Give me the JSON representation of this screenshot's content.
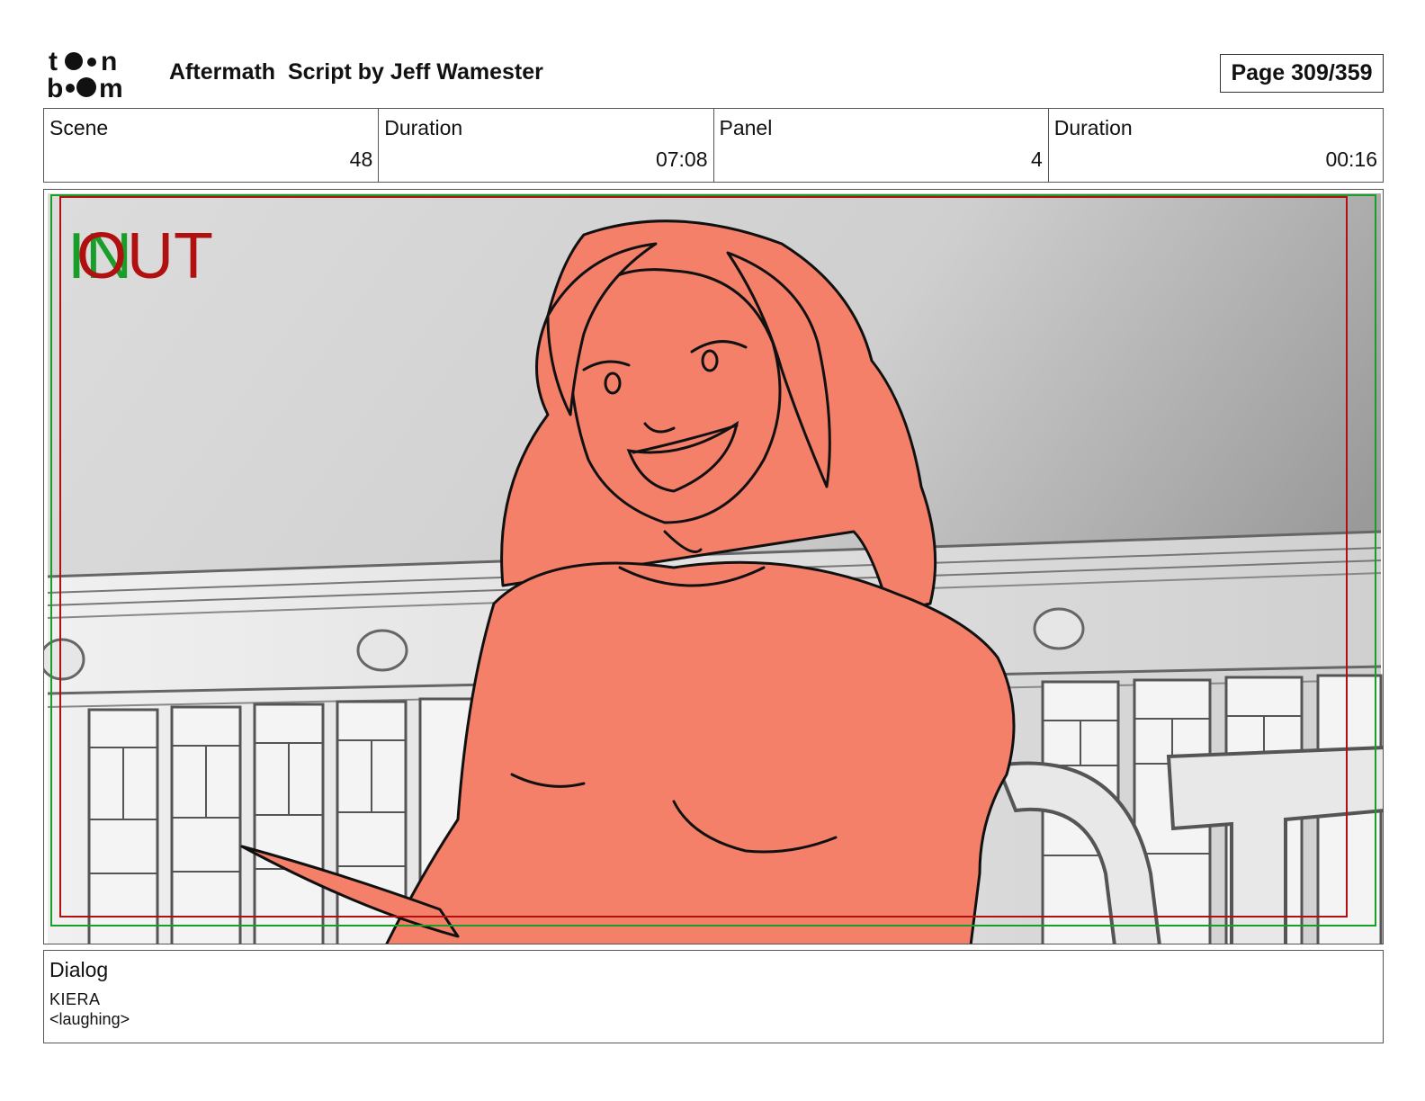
{
  "header": {
    "logo_text": "toon boom",
    "title": "Aftermath  Script by Jeff Wamester",
    "page": "Page 309/359"
  },
  "info": {
    "scene_label": "Scene",
    "scene_value": "48",
    "duration_label": "Duration",
    "duration_value": "07:08",
    "panel_label": "Panel",
    "panel_value": "4",
    "panel_duration_label": "Duration",
    "panel_duration_value": "00:16"
  },
  "panel_image": {
    "in_marker": "IN",
    "out_marker": "OUT",
    "in_color": "#1a9e2a",
    "out_color": "#b01010",
    "skin_color": "#f5806a",
    "icon": "storyboard-sketch-character"
  },
  "dialog": {
    "label": "Dialog",
    "speaker": "KIERA",
    "line": "<laughing>"
  }
}
